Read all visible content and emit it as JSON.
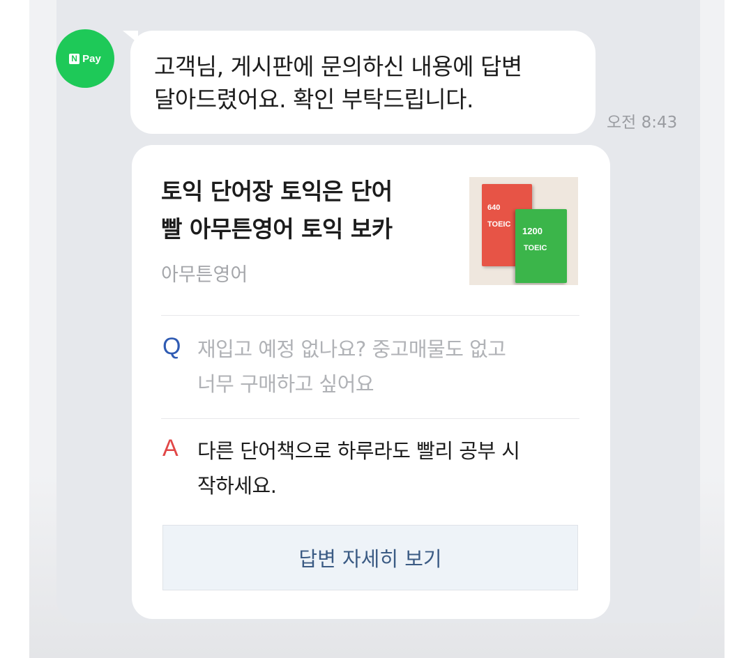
{
  "sender": {
    "avatar_logo_n": "N",
    "avatar_logo_text": "Pay",
    "avatar_color": "#1ec958"
  },
  "message": {
    "line1": "고객님, 게시판에 문의하신 내용에 답변",
    "line2": "달아드렸어요. 확인 부탁드립니다.",
    "timestamp": "오전 8:43"
  },
  "card": {
    "title_line1": "토익 단어장 토익은 단어",
    "title_line2": "빨 아무튼영어 토익 보카",
    "seller": "아무튼영어",
    "thumbnail": {
      "book1_label": "640",
      "book1_sub": "TOEIC",
      "book2_label": "1200",
      "book2_sub": "TOEIC"
    },
    "question_marker": "Q",
    "question_line1": "재입고 예정 없나요? 중고매물도 없고",
    "question_line2": "너무 구매하고 싶어요",
    "answer_marker": "A",
    "answer_line1": "다른 단어책으로 하루라도 빨리 공부 시",
    "answer_line2": "작하세요.",
    "detail_button": "답변 자세히 보기"
  },
  "colors": {
    "question_marker": "#2f5bb3",
    "answer_marker": "#e14747",
    "button_text": "#3b5b84"
  }
}
